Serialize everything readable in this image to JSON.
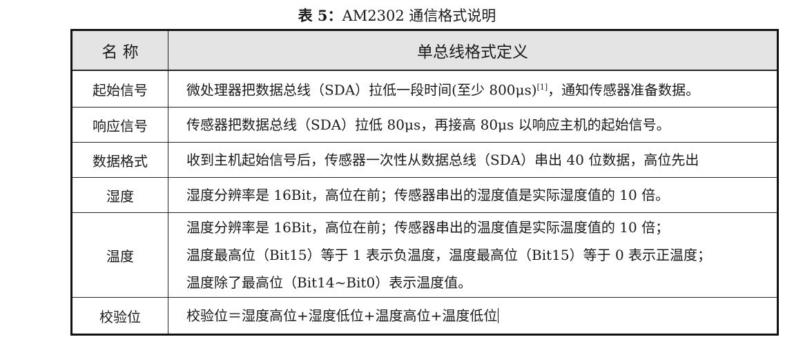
{
  "caption": {
    "label": "表 5：",
    "title": "AM2302 通信格式说明"
  },
  "table": {
    "headers": [
      "名 称",
      "单总线格式定义"
    ],
    "rows": [
      {
        "name": "起始信号",
        "lines": [
          {
            "pre": "微处理器把数据总线（SDA）拉低一段时间(至少 800μs)",
            "sup": "[1]",
            "post": "，通知传感器准备数据。"
          }
        ]
      },
      {
        "name": "响应信号",
        "lines": [
          {
            "pre": "传感器把数据总线（SDA）拉低 80μs，再接高 80μs 以响应主机的起始信号。"
          }
        ]
      },
      {
        "name": "数据格式",
        "lines": [
          {
            "pre": "收到主机起始信号后，传感器一次性从数据总线（SDA）串出 40 位数据，高位先出"
          }
        ]
      },
      {
        "name": "湿度",
        "lines": [
          {
            "pre": "湿度分辨率是 16Bit，高位在前；传感器串出的湿度值是实际湿度值的 10 倍。"
          }
        ]
      },
      {
        "name": "温度",
        "lines": [
          {
            "pre": "温度分辨率是 16Bit，高位在前；传感器串出的温度值是实际温度值的 10 倍；"
          },
          {
            "pre": "温度最高位（Bit15）等于 1 表示负温度，温度最高位（Bit15）等于 0 表示正温度；"
          },
          {
            "pre": "温度除了最高位（Bit14~Bit0）表示温度值。"
          }
        ]
      },
      {
        "name": "校验位",
        "lines": [
          {
            "pre": "校验位＝湿度高位+湿度低位+温度高位+温度低位"
          }
        ]
      }
    ]
  }
}
